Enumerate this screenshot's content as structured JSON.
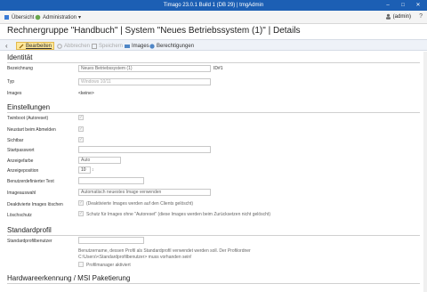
{
  "window": {
    "title": "Timago 23.0.1 Build 1 (DB 29) | tmgAdmin"
  },
  "menubar": {
    "overview": "Übersicht",
    "administration": "Administration",
    "user": "(admin)"
  },
  "headline": "Rechnergruppe \"Handbuch\" | System \"Neues Betriebssystem (1)\" | Details",
  "toolbar": {
    "edit": "Bearbeiten",
    "cancel": "Abbrechen",
    "save": "Speichern",
    "images": "Images",
    "permissions": "Berechtigungen"
  },
  "identity": {
    "heading": "Identität",
    "name_label": "Bezeichnung",
    "name_value": "Neues Betriebssystem (1)",
    "id_text": "ID#1",
    "type_label": "Typ",
    "type_value": "Windows 10/11",
    "images_label": "Images",
    "images_value": "<keine>"
  },
  "settings": {
    "heading": "Einstellungen",
    "twinboot_label": "Twinboot (Autoreset)",
    "restart_label": "Neustart beim Abmelden",
    "visible_label": "Sichtbar",
    "startpass_label": "Startpasswort",
    "color_label": "Anzeigefarbe",
    "color_value": "Auto",
    "position_label": "Anzeigeposition",
    "position_value": "10",
    "usertext_label": "Benutzerdefinierter Text",
    "imagesel_label": "Imageauswahl",
    "imagesel_value": "Automatisch neuestes Image verwenden",
    "deactivated_label": "Deaktivierte Images löschen",
    "deactivated_note": "(Deaktivierte Images werden auf den Clients gelöscht)",
    "protect_label": "Löschschutz",
    "protect_note": "Schutz für Images ohne \"Autoreset\" (diese Images werden beim Zurücksetzen nicht gelöscht)"
  },
  "profile": {
    "heading": "Standardprofil",
    "user_label": "Standardprofilbenutzer",
    "hint_line1": "Benutzername, dessen Profil als Standardprofil verwendet werden soll. Der Profilordner",
    "hint_line2": "C:\\Users\\<Standardprofilbenutzer> muss vorhanden sein!",
    "manager_label": "Profilmanager aktiviert"
  },
  "hardware": {
    "heading": "Hardwareerkennung / MSI Paketierung"
  },
  "colors": {
    "titlebar": "#1c5fb4",
    "toolbar_active": "#fde79a"
  }
}
